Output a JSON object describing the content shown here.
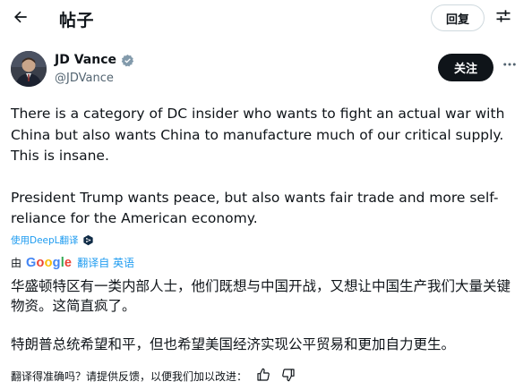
{
  "header": {
    "back_icon": "arrow-left-icon",
    "title": "帖子",
    "reply_label": "回复",
    "filter_icon": "sliders-icon"
  },
  "author": {
    "name": "JD Vance",
    "handle": "@JDVance",
    "verified_icon": "verified-badge-icon",
    "verified_color": "#829aab",
    "follow_label": "关注",
    "more_icon": "more-horizontal-icon"
  },
  "tweet": {
    "paragraph_1": "There is a category of DC insider who wants to fight an actual war with China but also wants China to manufacture much of our critical supply. This is insane.",
    "paragraph_2": "President Trump wants peace, but also wants fair trade and more self-reliance for the American economy."
  },
  "deepl": {
    "label": "使用DeepL翻译",
    "icon": "deepl-icon"
  },
  "google_translate": {
    "from_label": "由",
    "logo_text": "Google",
    "translate_label": "翻译自 英语"
  },
  "translation": {
    "paragraph_1": "华盛顿特区有一类内部人士，他们既想与中国开战，又想让中国生产我们大量关键物资。这简直疯了。",
    "paragraph_2": "特朗普总统希望和平，但也希望美国经济实现公平贸易和更加自力更生。"
  },
  "feedback": {
    "prompt": "翻译得准确吗？请提供反馈，以便我们加以改进：",
    "thumbs_up_icon": "thumbs-up-icon",
    "thumbs_down_icon": "thumbs-down-icon"
  },
  "colors": {
    "text": "#0f1419",
    "secondary": "#536471",
    "link": "#1d9bf0",
    "follow_bg": "#0f1419"
  }
}
